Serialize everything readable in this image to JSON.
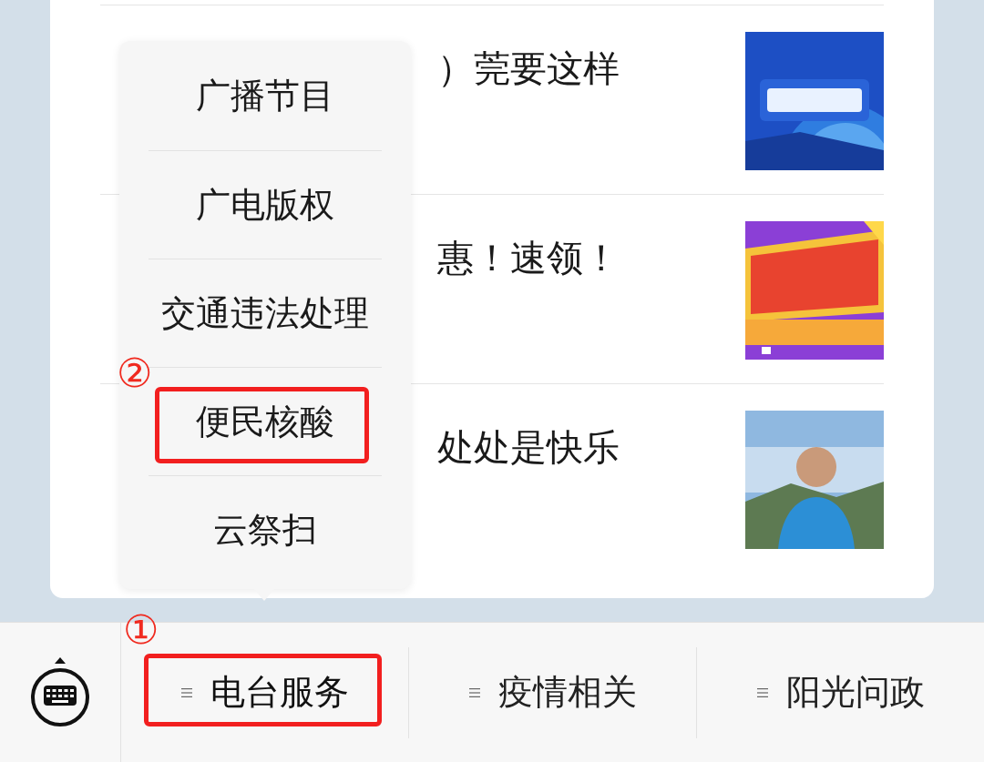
{
  "articles": [
    {
      "title": "）莞要这样"
    },
    {
      "title": "惠！速领！"
    },
    {
      "title": "处处是快乐"
    }
  ],
  "popup_menu": {
    "items": [
      {
        "label": "广播节目"
      },
      {
        "label": "广电版权"
      },
      {
        "label": "交通违法处理"
      },
      {
        "label": "便民核酸"
      },
      {
        "label": "云祭扫"
      }
    ]
  },
  "bottom_menu": {
    "tabs": [
      {
        "label": "电台服务",
        "expanded": true
      },
      {
        "label": "疫情相关",
        "expanded": false
      },
      {
        "label": "阳光问政",
        "expanded": false
      }
    ]
  },
  "annotations": [
    {
      "label": "②",
      "kind": "item"
    },
    {
      "label": "①",
      "kind": "tab"
    }
  ]
}
